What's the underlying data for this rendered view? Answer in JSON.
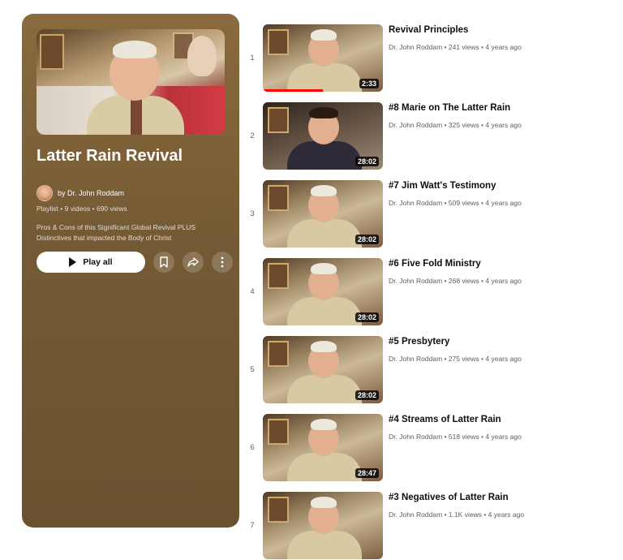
{
  "playlist": {
    "title": "Latter Rain Revival",
    "owner": "by Dr. John Roddam",
    "meta": "Playlist • 9 videos • 690 views",
    "description": "Pros & Cons of this Significant Global Revival PLUS Distinctives that impacted the Body of Christ",
    "play_all_label": "Play all",
    "icons": [
      "play-icon",
      "save-icon",
      "share-icon",
      "more-icon"
    ]
  },
  "videos": [
    {
      "index": "1",
      "title": "Revival Principles",
      "channel": "Dr. John Roddam",
      "views": "241 views",
      "age": "4 years ago",
      "duration": "2:33",
      "watched": 0.5
    },
    {
      "index": "2",
      "title": "#8 Marie on The Latter Rain",
      "channel": "Dr. John Roddam",
      "views": "325 views",
      "age": "4 years ago",
      "duration": "28:02"
    },
    {
      "index": "3",
      "title": "#7 Jim Watt's Testimony",
      "channel": "Dr. John Roddam",
      "views": "509 views",
      "age": "4 years ago",
      "duration": "28:02"
    },
    {
      "index": "4",
      "title": "#6 Five Fold Ministry",
      "channel": "Dr. John Roddam",
      "views": "268 views",
      "age": "4 years ago",
      "duration": "28:02"
    },
    {
      "index": "5",
      "title": "#5 Presbytery",
      "channel": "Dr. John Roddam",
      "views": "275 views",
      "age": "4 years ago",
      "duration": "28:02"
    },
    {
      "index": "6",
      "title": "#4 Streams of Latter Rain",
      "channel": "Dr. John Roddam",
      "views": "518 views",
      "age": "4 years ago",
      "duration": "28:47"
    },
    {
      "index": "7",
      "title": "#3 Negatives of Latter Rain",
      "channel": "Dr. John Roddam",
      "views": "1.1K views",
      "age": "4 years ago",
      "duration": ""
    }
  ]
}
